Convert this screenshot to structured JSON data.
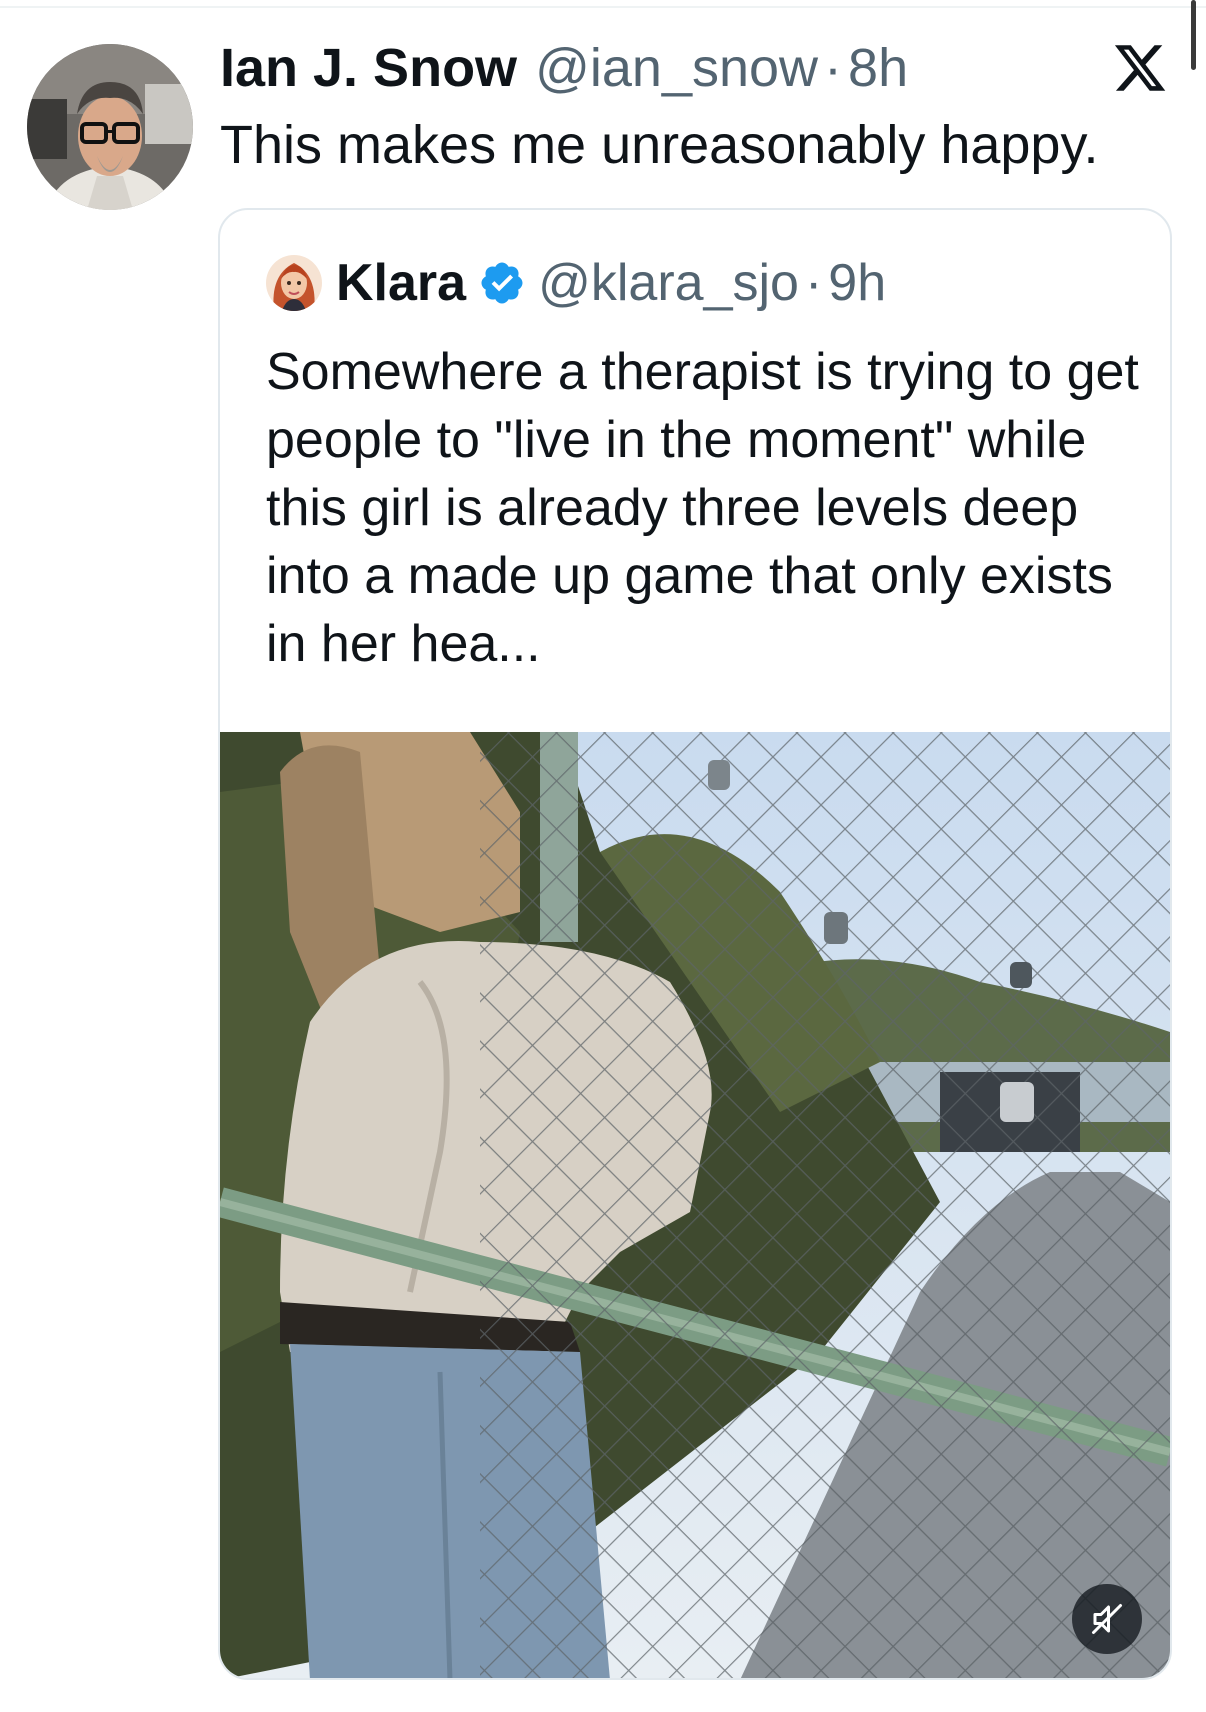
{
  "tweet": {
    "author_name": "Ian J. Snow",
    "author_handle": "@ian_snow",
    "separator": "·",
    "time": "8h",
    "text": "This makes me unreasonably happy."
  },
  "quoted_tweet": {
    "author_name": "Klara",
    "author_handle": "@klara_sjo",
    "separator": "·",
    "time": "9h",
    "verified": true,
    "text": "Somewhere a therapist is trying to get people to \"live in the moment\" while this girl is already three levels deep into a made up game that only exists in her hea..."
  },
  "media": {
    "type": "video",
    "muted": true
  },
  "icons": {
    "brand": "x-logo-icon",
    "verified": "verified-badge-icon",
    "sound": "speaker-muted-icon"
  },
  "colors": {
    "text_primary": "#0f1419",
    "text_secondary": "#536471",
    "verified_blue": "#1d9bf0",
    "card_border": "#e1e8ed"
  }
}
